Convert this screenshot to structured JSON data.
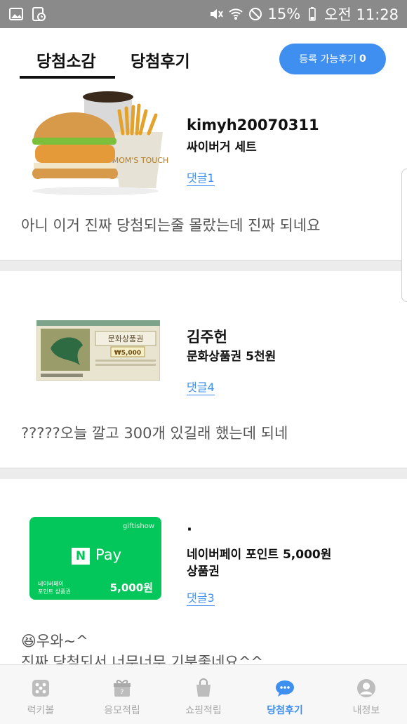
{
  "status_bar": {
    "battery": "15%",
    "time": "오전 11:28"
  },
  "tabs": {
    "active": "당첨소감",
    "second": "당첨후기"
  },
  "register_button": {
    "label": "등록 가능후기",
    "count": "0"
  },
  "posts": [
    {
      "user": "kimyh20070311",
      "prize": "싸이버거 세트",
      "comments": "댓글1",
      "review": "아니 이거 진짜 당첨되는줄 몰랐는데 진짜 되네요",
      "image_text": "MOM'S TOUCH"
    },
    {
      "user": "김주헌",
      "prize": "문화상품권 5천원",
      "comments": "댓글4",
      "review": "?????오늘 깔고 300개 있길래 했는데 되네",
      "image_text": "문화상품권",
      "image_amount": "₩5,000"
    },
    {
      "user": "·",
      "prize": "네이버페이 포인트 5,000원\n상품권",
      "comments": "댓글3",
      "review": "😆우와~^\n진짜 당첨되서 너무너무 기분좋네요^^",
      "card": {
        "brand": "giftishow",
        "logo_letter": "N",
        "logo_text": "Pay",
        "caption": "네이버페이\n포인트 상품권",
        "amount": "5,000원"
      }
    }
  ],
  "bottom_nav": [
    {
      "label": "럭키볼",
      "icon": "dice-icon"
    },
    {
      "label": "응모적립",
      "icon": "gift-icon"
    },
    {
      "label": "쇼핑적립",
      "icon": "shopping-bag-icon"
    },
    {
      "label": "당첨후기",
      "icon": "chat-icon"
    },
    {
      "label": "내정보",
      "icon": "profile-icon"
    }
  ],
  "colors": {
    "accent": "#3f8ff0",
    "statusbar": "#8a8a8a",
    "naver_green": "#03c75a"
  }
}
